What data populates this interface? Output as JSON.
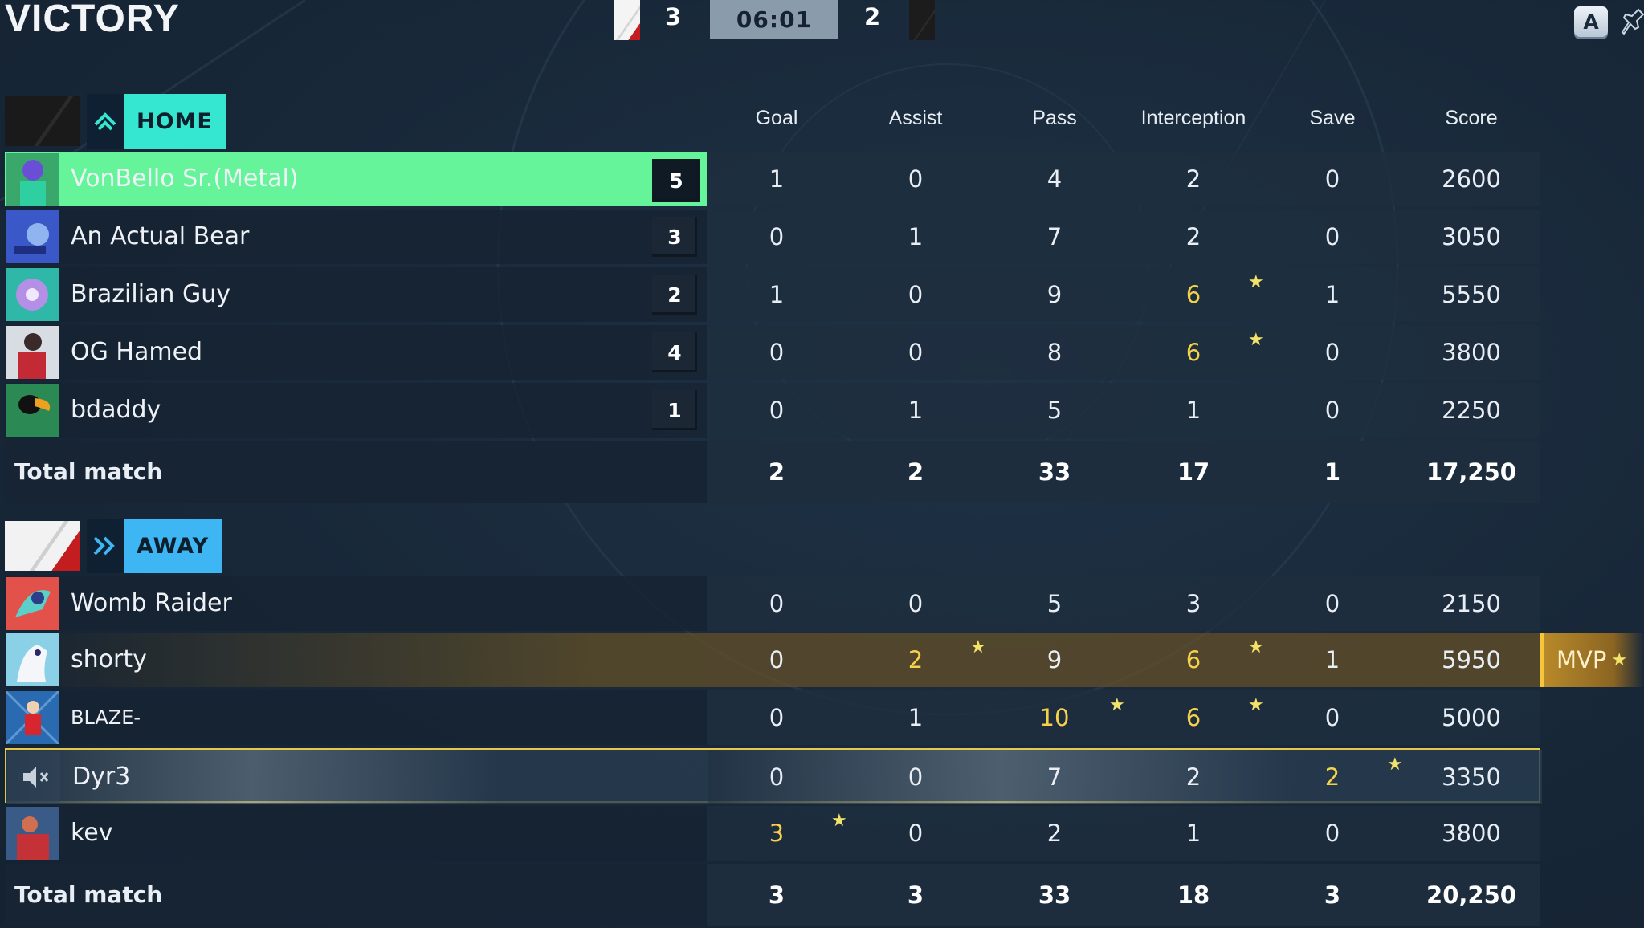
{
  "header": {
    "result": "VICTORY",
    "home_score": "3",
    "away_score": "2",
    "timer": "06:01",
    "a_button": "A"
  },
  "columns": [
    "Goal",
    "Assist",
    "Pass",
    "Interception",
    "Save",
    "Score"
  ],
  "home": {
    "label": "HOME",
    "players": [
      {
        "name": "VonBello Sr.(Metal)",
        "rank": "5",
        "goal": "1",
        "assist": "0",
        "pass": "4",
        "interception": "2",
        "save": "0",
        "score": "2600"
      },
      {
        "name": "An Actual Bear",
        "rank": "3",
        "goal": "0",
        "assist": "1",
        "pass": "7",
        "interception": "2",
        "save": "0",
        "score": "3050"
      },
      {
        "name": "Brazilian Guy",
        "rank": "2",
        "goal": "1",
        "assist": "0",
        "pass": "9",
        "interception": "6",
        "save": "1",
        "score": "5550"
      },
      {
        "name": "OG Hamed",
        "rank": "4",
        "goal": "0",
        "assist": "0",
        "pass": "8",
        "interception": "6",
        "save": "0",
        "score": "3800"
      },
      {
        "name": "bdaddy",
        "rank": "1",
        "goal": "0",
        "assist": "1",
        "pass": "5",
        "interception": "1",
        "save": "0",
        "score": "2250"
      }
    ],
    "total": {
      "label": "Total match",
      "goal": "2",
      "assist": "2",
      "pass": "33",
      "interception": "17",
      "save": "1",
      "score": "17,250"
    }
  },
  "away": {
    "label": "AWAY",
    "players": [
      {
        "name": "Womb Raider",
        "goal": "0",
        "assist": "0",
        "pass": "5",
        "interception": "3",
        "save": "0",
        "score": "2150"
      },
      {
        "name": "shorty",
        "goal": "0",
        "assist": "2",
        "pass": "9",
        "interception": "6",
        "save": "1",
        "score": "5950"
      },
      {
        "name": "BLAZE-",
        "goal": "0",
        "assist": "1",
        "pass": "10",
        "interception": "6",
        "save": "0",
        "score": "5000"
      },
      {
        "name": "Dyr3",
        "goal": "0",
        "assist": "0",
        "pass": "7",
        "interception": "2",
        "save": "2",
        "score": "3350"
      },
      {
        "name": "kev",
        "goal": "3",
        "assist": "0",
        "pass": "2",
        "interception": "1",
        "save": "0",
        "score": "3800"
      }
    ],
    "total": {
      "label": "Total match",
      "goal": "3",
      "assist": "3",
      "pass": "33",
      "interception": "18",
      "save": "3",
      "score": "20,250"
    }
  },
  "mvp": {
    "label": "MVP",
    "star": "★"
  },
  "star_glyph": "★",
  "colors": {
    "home_accent": "#35e7d0",
    "away_accent": "#3fb6f4",
    "highlight_green": "#66f49a",
    "gold": "#f6d24b",
    "self_border": "#e6c94a"
  }
}
